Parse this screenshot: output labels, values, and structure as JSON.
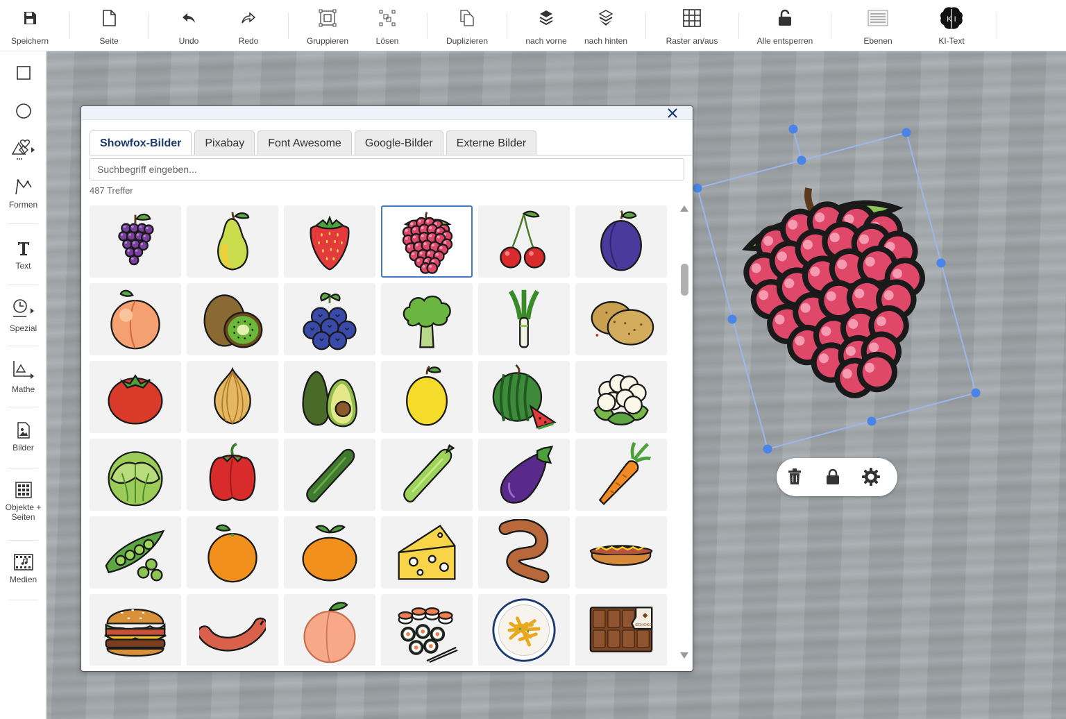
{
  "toolbar": {
    "items": [
      {
        "label": "Speichern",
        "icon": "save-icon"
      },
      {
        "label": "Seite",
        "icon": "page-icon"
      },
      {
        "label": "Undo",
        "icon": "undo-icon"
      },
      {
        "label": "Redo",
        "icon": "redo-icon"
      },
      {
        "label": "Gruppieren",
        "icon": "group-icon"
      },
      {
        "label": "Lösen",
        "icon": "ungroup-icon"
      },
      {
        "label": "Duplizieren",
        "icon": "duplicate-icon"
      },
      {
        "label": "nach vorne",
        "icon": "bring-forward-icon"
      },
      {
        "label": "nach hinten",
        "icon": "send-backward-icon"
      },
      {
        "label": "Raster an/aus",
        "icon": "grid-icon"
      },
      {
        "label": "Alle entsperren",
        "icon": "unlock-icon"
      },
      {
        "label": "Ebenen",
        "icon": "layers-icon"
      },
      {
        "label": "KI-Text",
        "icon": "ai-brain-icon"
      }
    ],
    "ai_badge": "K I"
  },
  "sidebar": {
    "items": [
      {
        "label": "",
        "icon": "rectangle-icon"
      },
      {
        "label": "",
        "icon": "circle-icon"
      },
      {
        "label": "",
        "icon": "shapes-icon"
      },
      {
        "label": "Formen",
        "icon": "polyline-icon"
      },
      {
        "label": "Text",
        "icon": "text-icon"
      },
      {
        "label": "Spezial",
        "icon": "clock-icon"
      },
      {
        "label": "Mathe",
        "icon": "math-icon"
      },
      {
        "label": "Bilder",
        "icon": "image-icon"
      },
      {
        "label": "Objekte + Seiten",
        "icon": "objects-grid-icon"
      },
      {
        "label": "Medien",
        "icon": "media-icon"
      }
    ]
  },
  "dialog": {
    "tabs": [
      "Showfox-Bilder",
      "Pixabay",
      "Font Awesome",
      "Google-Bilder",
      "Externe Bilder"
    ],
    "active_tab": "Showfox-Bilder",
    "search_placeholder": "Suchbegriff eingeben...",
    "search_value": "",
    "hits": "487 Treffer",
    "images": [
      "grapes",
      "pear",
      "strawberry",
      "raspberry",
      "cherries",
      "plum",
      "peach",
      "kiwi",
      "blueberries",
      "broccoli",
      "leek",
      "potatoes",
      "tomato",
      "onion",
      "avocado",
      "lemon",
      "watermelon",
      "cauliflower",
      "lettuce",
      "bell-pepper",
      "cucumber",
      "cucumber-light",
      "eggplant",
      "carrot",
      "peas",
      "orange",
      "tangerine",
      "cheese",
      "sausage-curved",
      "hotdog",
      "burger",
      "sausage",
      "peach-whole",
      "sushi",
      "fries-plate",
      "chocolate"
    ],
    "selected_image": "raspberry",
    "chocolate_label": "SCHOKO"
  },
  "canvas": {
    "selected_object": "raspberry",
    "object_toolbar": [
      "trash-icon",
      "lock-icon",
      "settings-icon"
    ]
  },
  "colors": {
    "accent": "#3f79c6",
    "handle": "#4a84e8",
    "tab_active_text": "#1a3a6e"
  }
}
